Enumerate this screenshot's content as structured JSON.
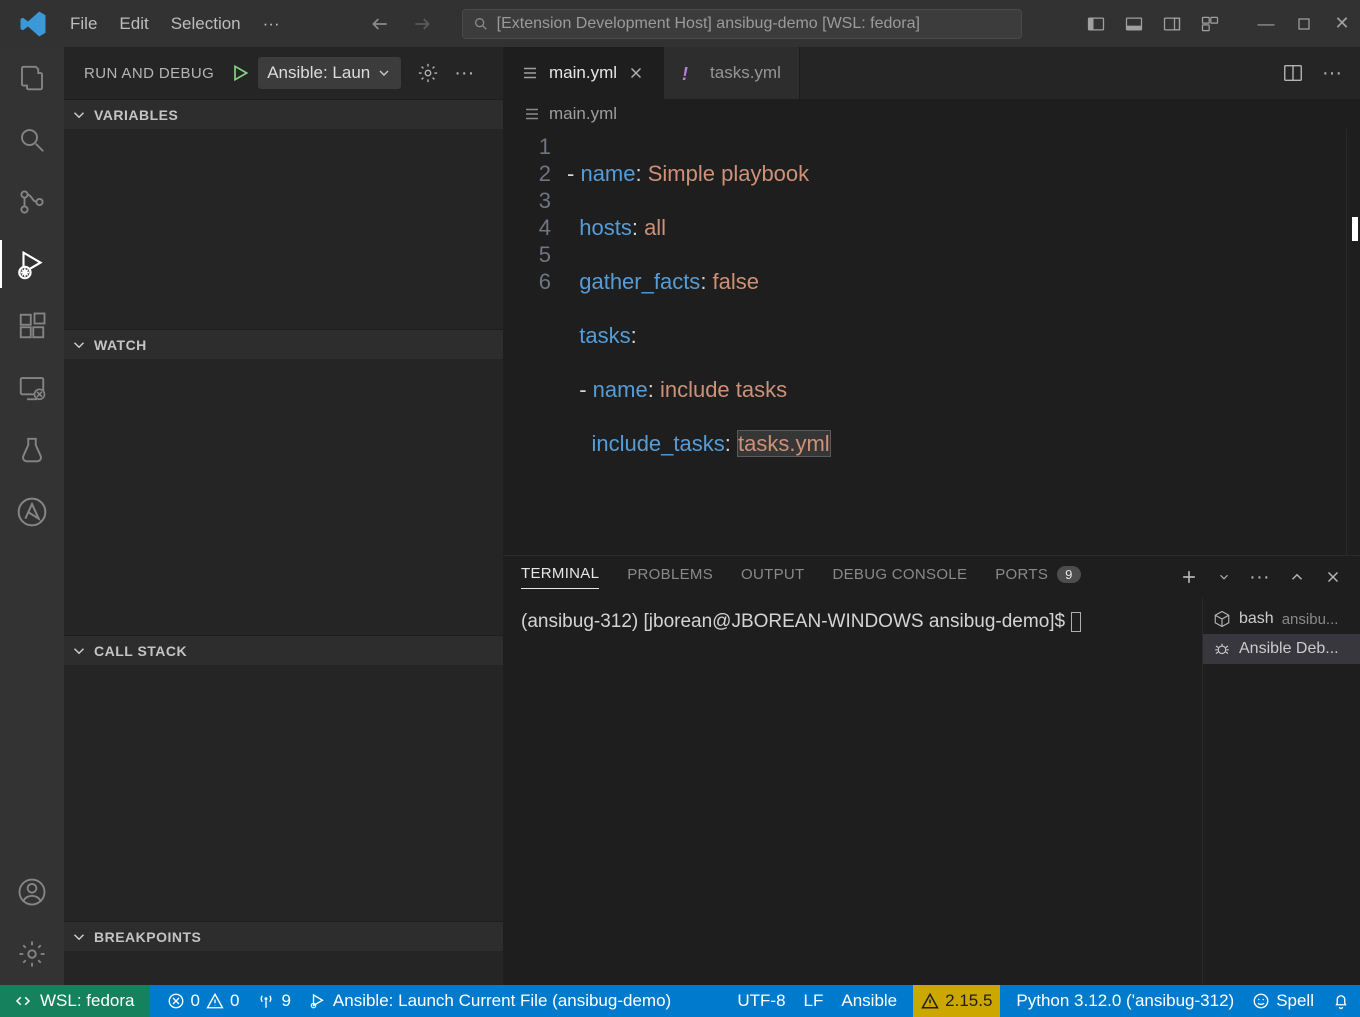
{
  "titlebar": {
    "menu": [
      "File",
      "Edit",
      "Selection"
    ],
    "search_text": "[Extension Development Host] ansibug-demo [WSL: fedora]"
  },
  "sidebar": {
    "title": "RUN AND DEBUG",
    "launch_label": "Ansible: Laun",
    "sections": {
      "variables": "VARIABLES",
      "watch": "WATCH",
      "callstack": "CALL STACK",
      "breakpoints": "BREAKPOINTS"
    }
  },
  "editor": {
    "tabs": [
      {
        "file": "main.yml",
        "active": true,
        "icon": "yaml"
      },
      {
        "file": "tasks.yml",
        "active": false,
        "icon": "yaml-alt"
      }
    ],
    "breadcrumb": "main.yml",
    "lines": [
      "1",
      "2",
      "3",
      "4",
      "5",
      "6"
    ],
    "code": {
      "l1": {
        "prefix": "- ",
        "key": "name",
        "val": "Simple playbook"
      },
      "l2": {
        "prefix": "  ",
        "key": "hosts",
        "val": "all"
      },
      "l3": {
        "prefix": "  ",
        "key": "gather_facts",
        "val": "false"
      },
      "l4": {
        "prefix": "  ",
        "key": "tasks",
        "val": ""
      },
      "l5": {
        "prefix": "  - ",
        "key": "name",
        "val": "include tasks"
      },
      "l6": {
        "prefix": "    ",
        "key": "include_tasks",
        "val": "tasks.yml"
      }
    }
  },
  "panel": {
    "tabs": [
      "TERMINAL",
      "PROBLEMS",
      "OUTPUT",
      "DEBUG CONSOLE",
      "PORTS"
    ],
    "ports_badge": "9",
    "terminal_line": "(ansibug-312) [jborean@JBOREAN-WINDOWS ansibug-demo]$",
    "terms": [
      {
        "icon": "box",
        "name": "bash",
        "sub": "ansibu..."
      },
      {
        "icon": "bug",
        "name": "Ansible Deb...",
        "sub": ""
      }
    ]
  },
  "status": {
    "remote": "WSL: fedora",
    "err": "0",
    "warn": "0",
    "ports": "9",
    "debug_target": "Ansible: Launch Current File (ansibug-demo)",
    "encoding": "UTF-8",
    "eol": "LF",
    "lang": "Ansible",
    "ansible_version": "2.15.5",
    "python": "Python 3.12.0 ('ansibug-312)",
    "spell": "Spell"
  }
}
